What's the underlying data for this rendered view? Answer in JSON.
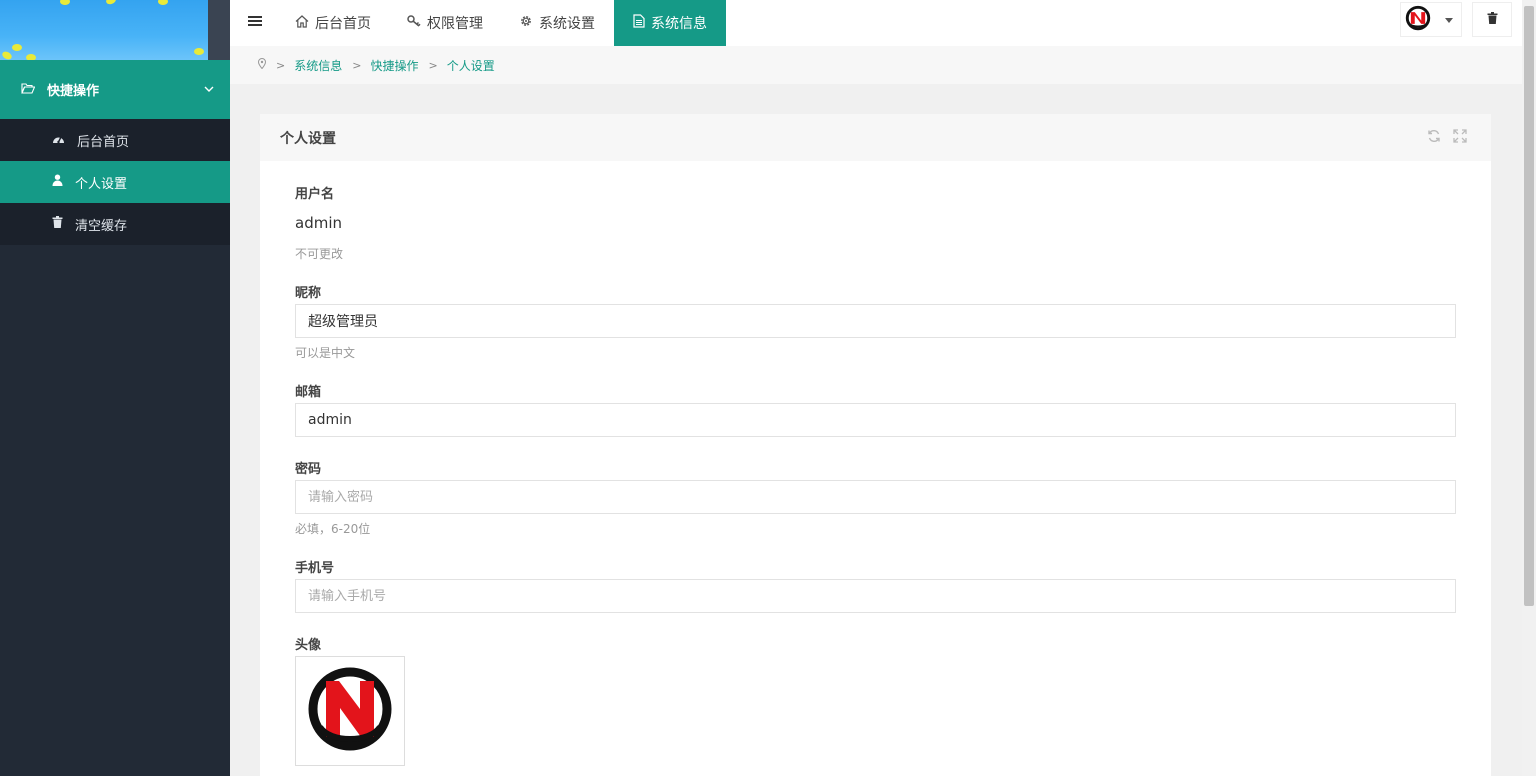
{
  "sidebar": {
    "group_label": "快捷操作",
    "items": [
      {
        "label": "后台首页",
        "icon": "dashboard-icon"
      },
      {
        "label": "个人设置",
        "icon": "user-icon",
        "active": true
      },
      {
        "label": "清空缓存",
        "icon": "trash-icon"
      }
    ]
  },
  "topbar": {
    "tabs": [
      {
        "label": "后台首页",
        "icon": "home-icon"
      },
      {
        "label": "权限管理",
        "icon": "key-icon"
      },
      {
        "label": "系统设置",
        "icon": "gear-icon"
      },
      {
        "label": "系统信息",
        "icon": "document-icon",
        "active": true
      }
    ]
  },
  "breadcrumb": [
    "系统信息",
    "快捷操作",
    "个人设置"
  ],
  "panel": {
    "title": "个人设置",
    "fields": {
      "username": {
        "label": "用户名",
        "value": "admin",
        "help": "不可更改"
      },
      "nickname": {
        "label": "昵称",
        "value": "超级管理员",
        "help": "可以是中文"
      },
      "email": {
        "label": "邮箱",
        "value": "admin"
      },
      "password": {
        "label": "密码",
        "placeholder": "请输入密码",
        "help": "必填，6-20位"
      },
      "phone": {
        "label": "手机号",
        "placeholder": "请输入手机号"
      },
      "avatar": {
        "label": "头像"
      }
    }
  },
  "colors": {
    "accent": "#159a87",
    "sidebar_bg": "#222a36",
    "logo_red": "#e3141b"
  }
}
